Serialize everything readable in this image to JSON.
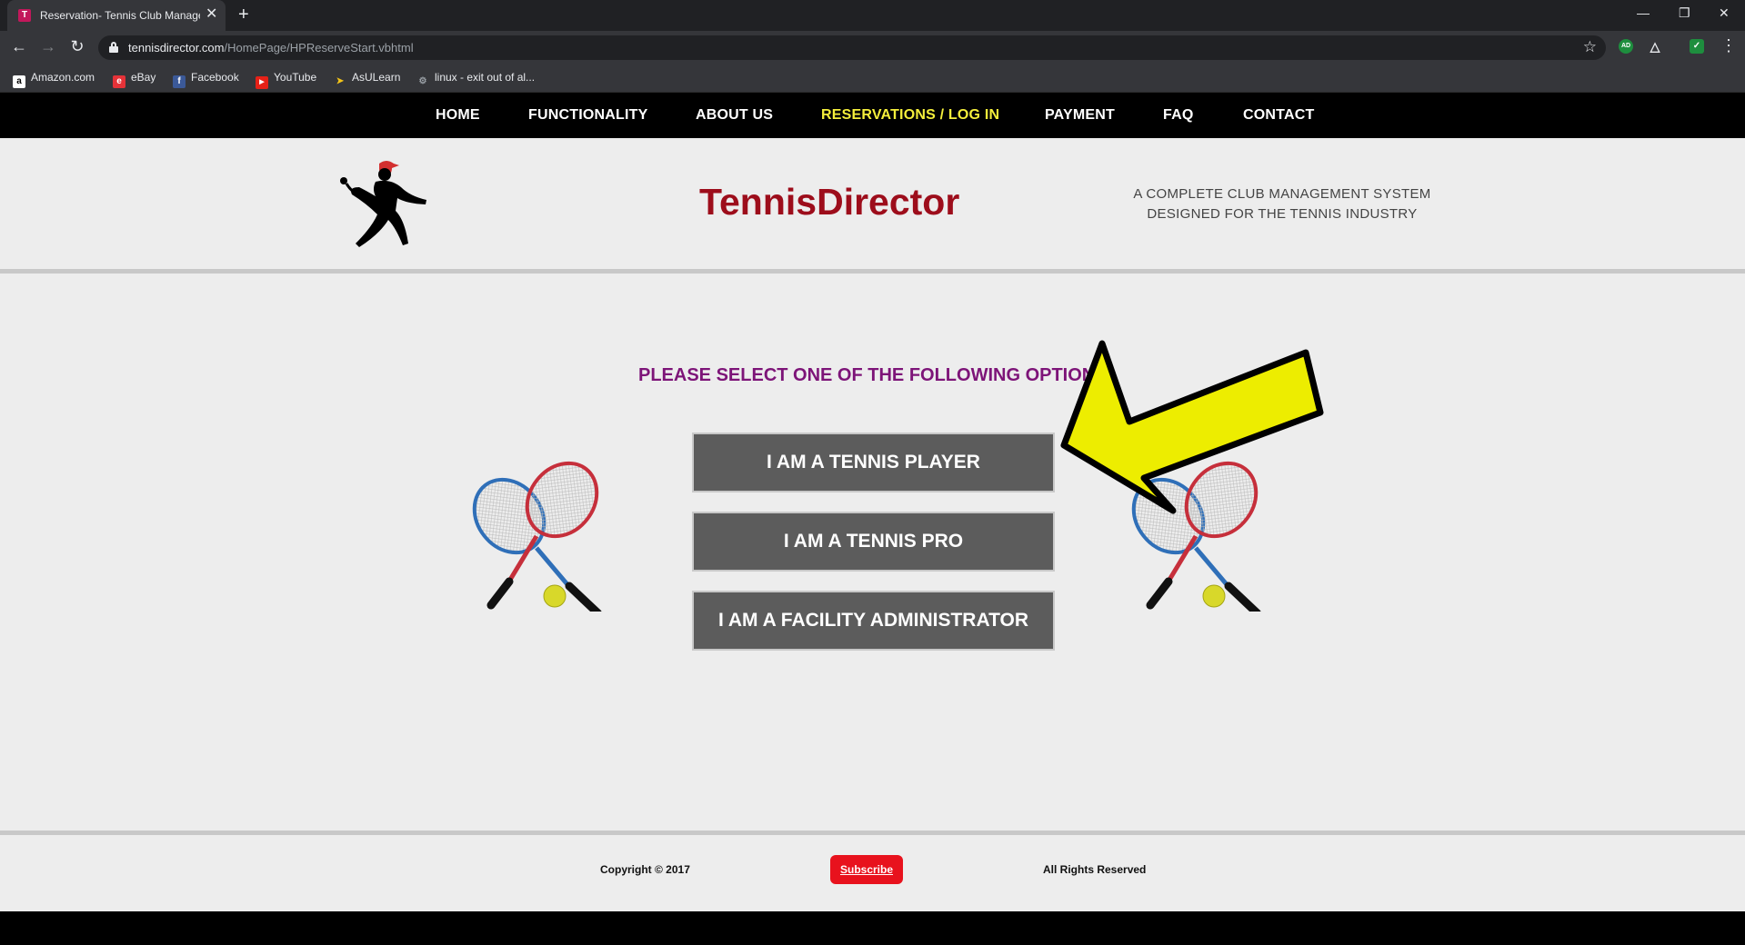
{
  "browser": {
    "tab_title": "Reservation- Tennis Club Manage",
    "tab_close": "✕",
    "new_tab": "+",
    "url_domain": "tennisdirector.com",
    "url_path": "/HomePage/HPReserveStart.vbhtml",
    "bookmarks": [
      {
        "label": "Amazon.com",
        "icon": "a"
      },
      {
        "label": "eBay",
        "icon": "e"
      },
      {
        "label": "Facebook",
        "icon": "f"
      },
      {
        "label": "YouTube",
        "icon": "▶"
      },
      {
        "label": "AsULearn",
        "icon": "➤"
      },
      {
        "label": "linux - exit out of al...",
        "icon": "⚙"
      }
    ],
    "extensions": [
      "AD"
    ]
  },
  "nav": {
    "items": [
      "HOME",
      "FUNCTIONALITY",
      "ABOUT US",
      "RESERVATIONS / LOG IN",
      "PAYMENT",
      "FAQ",
      "CONTACT"
    ],
    "active": "RESERVATIONS / LOG IN",
    "active_color": "#f4ee3b"
  },
  "header": {
    "brand": "TennisDirector",
    "brand_color": "#9d0d1b",
    "tagline_line1": "A COMPLETE CLUB MANAGEMENT SYSTEM",
    "tagline_line2": "DESIGNED FOR THE TENNIS INDUSTRY"
  },
  "main": {
    "prompt": "PLEASE SELECT ONE OF THE FOLLOWING OPTIONS",
    "prompt_color": "#7d1478",
    "options": [
      "I AM A TENNIS PLAYER",
      "I AM A TENNIS PRO",
      "I AM A FACILITY ADMINISTRATOR"
    ]
  },
  "footer": {
    "copyright": "Copyright © 2017",
    "subscribe": "Subscribe",
    "rights": "All Rights Reserved"
  }
}
